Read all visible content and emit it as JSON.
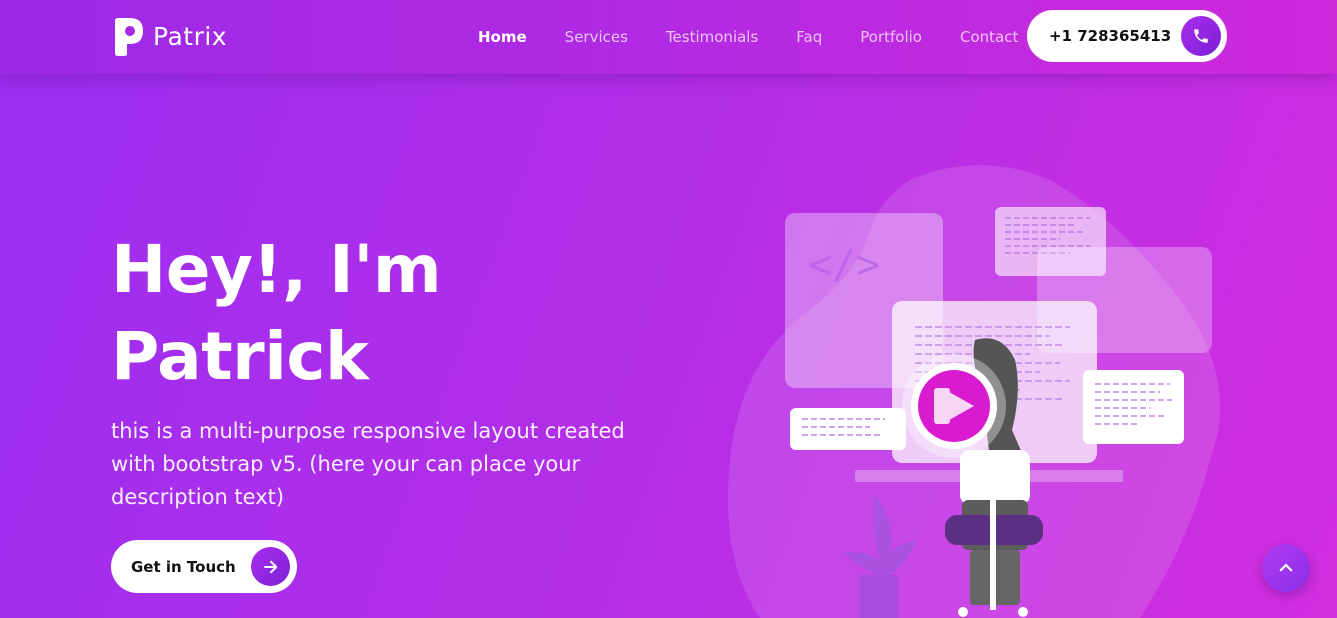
{
  "brand": {
    "name": "Patrix",
    "icon": "p-logo-icon"
  },
  "nav": {
    "items": [
      {
        "label": "Home",
        "active": true
      },
      {
        "label": "Services",
        "active": false
      },
      {
        "label": "Testimonials",
        "active": false
      },
      {
        "label": "Faq",
        "active": false
      },
      {
        "label": "Portfolio",
        "active": false
      },
      {
        "label": "Contact",
        "active": false
      }
    ],
    "phone": {
      "number": "+1 728365413",
      "icon": "phone-icon"
    }
  },
  "hero": {
    "title_line1": "Hey!, I'm",
    "title_line2": "Patrick",
    "description": "this is a multi-purpose responsive layout created with bootstrap v5. (here your can place your description text)",
    "cta_label": "Get in Touch",
    "cta_icon": "arrow-right-icon",
    "illustration_code_tag": "</>",
    "play_icon": "play-icon"
  },
  "back_to_top": {
    "icon": "chevron-up-icon"
  },
  "colors": {
    "gradient_start": "#9b2ef0",
    "gradient_end": "#d12edf",
    "accent": "#a92ef0",
    "play_button": "#d81bcf"
  }
}
